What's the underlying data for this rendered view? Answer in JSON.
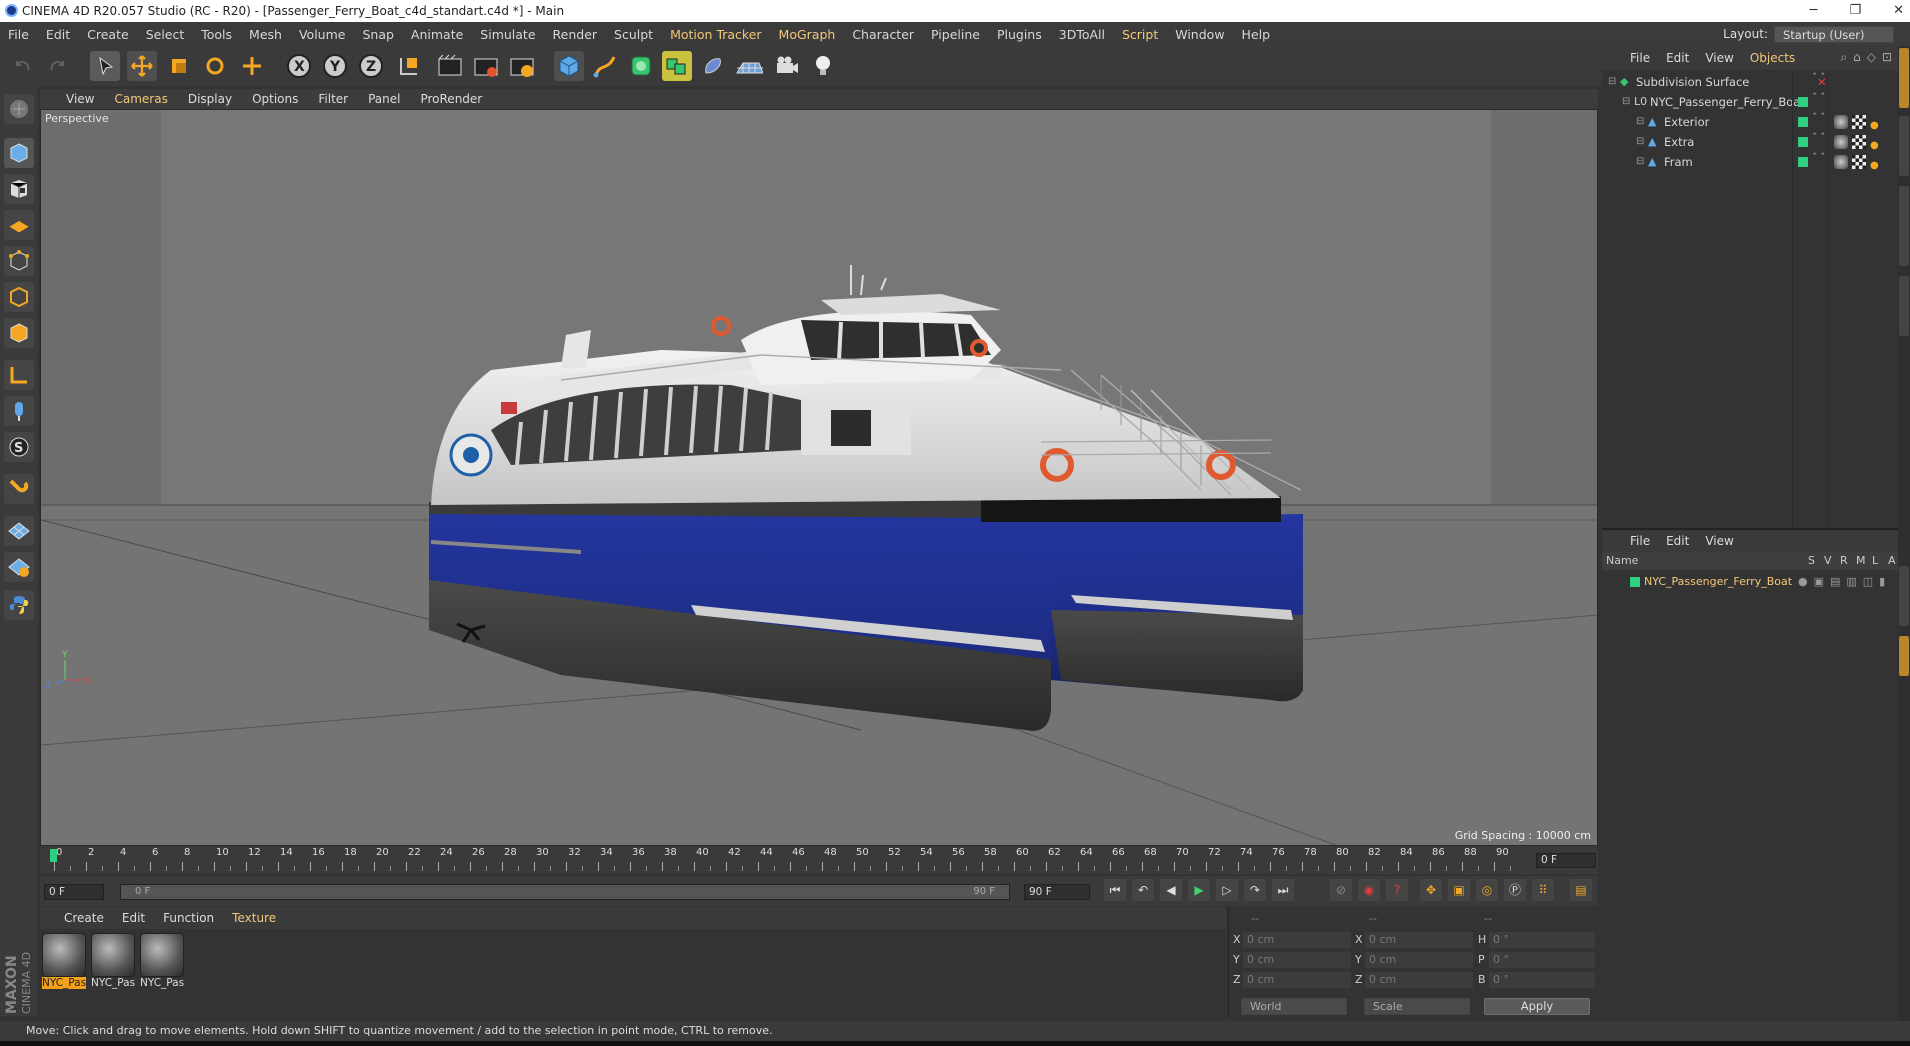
{
  "window": {
    "title": "CINEMA 4D R20.057 Studio (RC - R20) - [Passenger_Ferry_Boat_c4d_standart.c4d *] - Main",
    "controls": [
      "─",
      "❐",
      "✕"
    ]
  },
  "menubar": {
    "items": [
      "File",
      "Edit",
      "Create",
      "Select",
      "Tools",
      "Mesh",
      "Volume",
      "Snap",
      "Animate",
      "Simulate",
      "Render",
      "Sculpt",
      "Motion Tracker",
      "MoGraph",
      "Character",
      "Pipeline",
      "Plugins",
      "3DToAll",
      "Script",
      "Window",
      "Help"
    ],
    "highlighted": [
      "Motion Tracker",
      "MoGraph",
      "Script"
    ],
    "layout_label": "Layout:",
    "layout_value": "Startup (User)"
  },
  "viewport": {
    "menu": [
      "View",
      "Cameras",
      "Display",
      "Options",
      "Filter",
      "Panel",
      "ProRender"
    ],
    "highlighted": "Cameras",
    "label": "Perspective",
    "grid_spacing": "Grid Spacing : 10000 cm"
  },
  "timeline": {
    "ticks": [
      "0",
      "2",
      "4",
      "6",
      "8",
      "10",
      "12",
      "14",
      "16",
      "18",
      "20",
      "22",
      "24",
      "26",
      "28",
      "30",
      "32",
      "34",
      "36",
      "38",
      "40",
      "42",
      "44",
      "46",
      "48",
      "50",
      "52",
      "54",
      "56",
      "58",
      "60",
      "62",
      "64",
      "66",
      "68",
      "70",
      "72",
      "74",
      "76",
      "78",
      "80",
      "82",
      "84",
      "86",
      "88",
      "90"
    ],
    "current_frame": "0 F",
    "start_field": "0 F",
    "range_start": "0 F",
    "range_end": "90 F",
    "end_field": "90 F"
  },
  "materials": {
    "menu": [
      "Create",
      "Edit",
      "Function",
      "Texture"
    ],
    "items": [
      {
        "name": "NYC_Pas",
        "selected": true
      },
      {
        "name": "NYC_Pas",
        "selected": false
      },
      {
        "name": "NYC_Pas",
        "selected": false
      }
    ]
  },
  "coordinates": {
    "header": [
      "--",
      "--",
      "--"
    ],
    "rows": [
      {
        "a": "X",
        "av": "0 cm",
        "b": "X",
        "bv": "0 cm",
        "c": "H",
        "cv": "0 °"
      },
      {
        "a": "Y",
        "av": "0 cm",
        "b": "Y",
        "bv": "0 cm",
        "c": "P",
        "cv": "0 °"
      },
      {
        "a": "Z",
        "av": "0 cm",
        "b": "Z",
        "bv": "0 cm",
        "c": "B",
        "cv": "0 °"
      }
    ],
    "mode1": "World",
    "mode2": "Scale",
    "apply": "Apply"
  },
  "objects": {
    "menu": [
      "File",
      "Edit",
      "View",
      "Objects"
    ],
    "highlighted": "Objects",
    "items": [
      {
        "name": "Subdivision Surface",
        "indent": 0
      },
      {
        "name": "NYC_Passenger_Ferry_Boat",
        "indent": 1
      },
      {
        "name": "Exterior",
        "indent": 2
      },
      {
        "name": "Extra",
        "indent": 2
      },
      {
        "name": "Fram",
        "indent": 2
      }
    ]
  },
  "layers": {
    "menu": [
      "File",
      "Edit",
      "View"
    ],
    "columns": [
      "Name",
      "S",
      "V",
      "R",
      "M",
      "L",
      "A"
    ],
    "row": "NYC_Passenger_Ferry_Boat"
  },
  "status": "Move: Click and drag to move elements. Hold down SHIFT to quantize movement / add to the selection in point mode, CTRL to remove.",
  "colors": {
    "accent": "#f3a21a",
    "layer_green": "#2ecf7e",
    "hull_blue": "#1d2d86"
  }
}
